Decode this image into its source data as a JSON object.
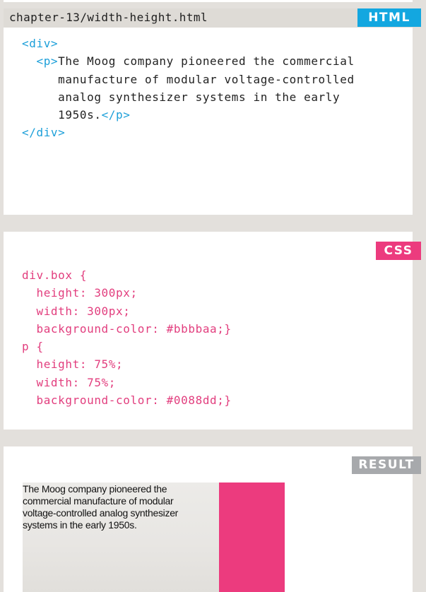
{
  "file": {
    "name": "chapter-13/width-height.html"
  },
  "tags": {
    "html": "HTML",
    "css": "CSS",
    "result": "RESULT"
  },
  "html_code": {
    "div_open": "<div>",
    "p_open": "<p>",
    "p_text_line1": "The Moog company pioneered the commercial",
    "p_text_line2": "manufacture of modular voltage-controlled",
    "p_text_line3": "analog synthesizer systems in the early",
    "p_text_line4": "1950s.",
    "p_close": "</p>",
    "div_close": "</div>"
  },
  "css_code": {
    "line1": "div.box {",
    "line2": "  height: 300px;",
    "line3": "  width: 300px;",
    "line4": "  background-color: #bbbbaa;}",
    "line5": "p {",
    "line6": "  height: 75%;",
    "line7": "  width: 75%;",
    "line8": "  background-color: #0088dd;}"
  },
  "result": {
    "paragraph": "The Moog company pioneered the commercial manufacture of modular voltage-controlled analog synthesizer systems in the early 1950s."
  },
  "colors": {
    "html_tag": "#13a7e0",
    "css_tag": "#ec3b7e",
    "result_tag": "#a7a9ac",
    "code_markup": "#1c9fd9",
    "code_css": "#e23e7e",
    "result_box": "#ec3b7e"
  }
}
